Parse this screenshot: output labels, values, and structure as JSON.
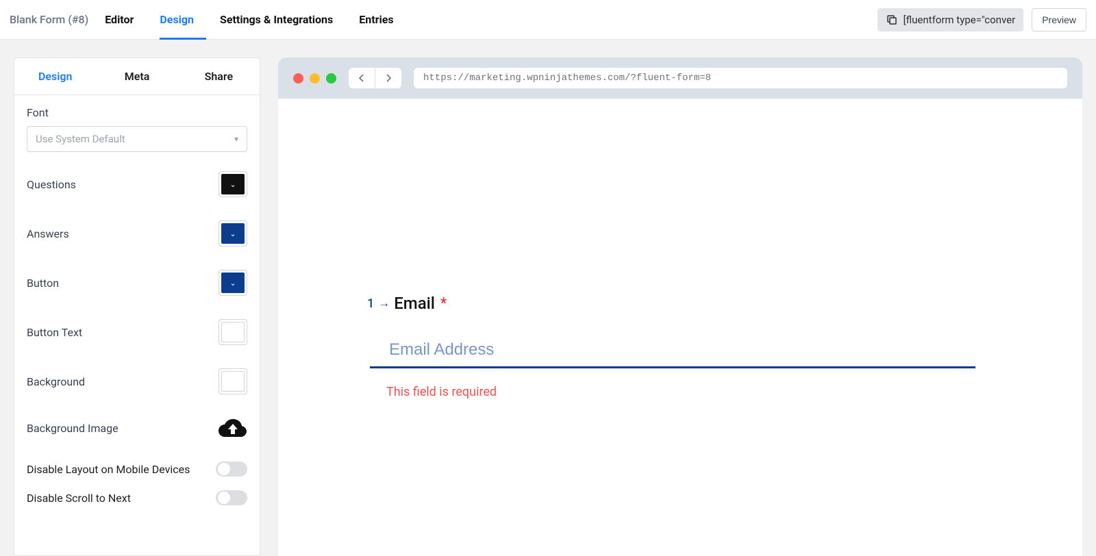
{
  "header": {
    "form_name": "Blank Form (#8)",
    "tabs": {
      "editor": "Editor",
      "design": "Design",
      "settings": "Settings & Integrations",
      "entries": "Entries"
    },
    "shortcode_text": "[fluentform type=\"conver",
    "preview_btn": "Preview"
  },
  "sidebar": {
    "tabs": {
      "design": "Design",
      "meta": "Meta",
      "share": "Share"
    },
    "font_heading": "Font",
    "font_placeholder": "Use System Default",
    "rows": {
      "questions": "Questions",
      "answers": "Answers",
      "button": "Button",
      "button_text": "Button Text",
      "background": "Background",
      "bg_image": "Background Image",
      "disable_mobile": "Disable Layout on Mobile Devices",
      "disable_scroll": "Disable Scroll to Next"
    },
    "colors": {
      "questions": "#111111",
      "answers": "#0c3d8d",
      "button": "#0c3d8d",
      "button_text": "#ffffff",
      "background": "#ffffff"
    }
  },
  "preview": {
    "url": "https://marketing.wpninjathemes.com/?fluent-form=8",
    "question_number": "1",
    "question_label": "Email",
    "input_placeholder": "Email Address",
    "error_message": "This field is required"
  }
}
